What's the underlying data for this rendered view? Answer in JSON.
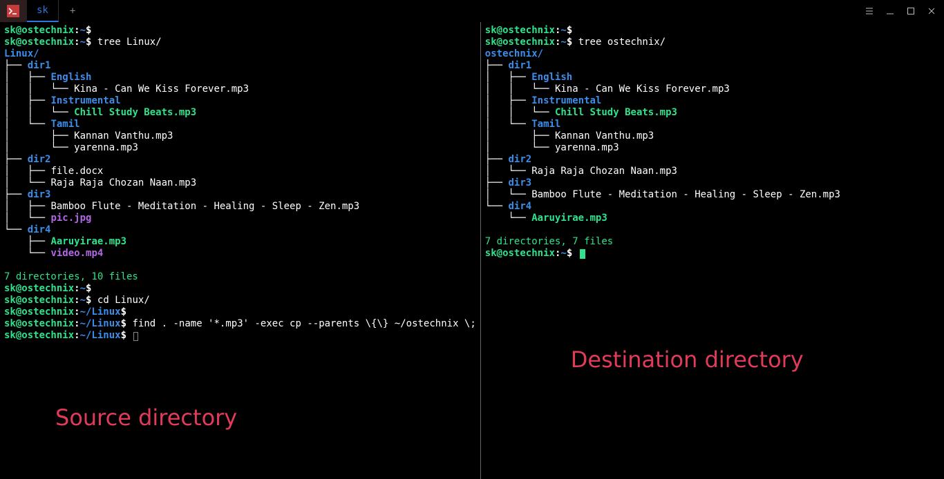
{
  "window": {
    "tab_label": "sk",
    "new_tab_glyph": "+"
  },
  "prompt": {
    "user_host": "sk@ostechnix",
    "home": "~",
    "linux_path": "~/Linux",
    "dollar": "$"
  },
  "left": {
    "cmd_tree": "tree Linux/",
    "root": "Linux/",
    "tree": [
      {
        "pfx": "├── ",
        "cls": "dir",
        "txt": "dir1"
      },
      {
        "pfx": "│   ├── ",
        "cls": "dir",
        "txt": "English"
      },
      {
        "pfx": "│   │   └── ",
        "cls": "file",
        "txt": "Kina - Can We Kiss Forever.mp3"
      },
      {
        "pfx": "│   ├── ",
        "cls": "dir",
        "txt": "Instrumental"
      },
      {
        "pfx": "│   │   └── ",
        "cls": "exec",
        "txt": "Chill Study Beats.mp3"
      },
      {
        "pfx": "│   └── ",
        "cls": "dir",
        "txt": "Tamil"
      },
      {
        "pfx": "│       ├── ",
        "cls": "file",
        "txt": "Kannan Vanthu.mp3"
      },
      {
        "pfx": "│       └── ",
        "cls": "file",
        "txt": "yarenna.mp3"
      },
      {
        "pfx": "├── ",
        "cls": "dir",
        "txt": "dir2"
      },
      {
        "pfx": "│   ├── ",
        "cls": "file",
        "txt": "file.docx"
      },
      {
        "pfx": "│   └── ",
        "cls": "file",
        "txt": "Raja Raja Chozan Naan.mp3"
      },
      {
        "pfx": "├── ",
        "cls": "dir",
        "txt": "dir3"
      },
      {
        "pfx": "│   ├── ",
        "cls": "file",
        "txt": "Bamboo Flute - Meditation - Healing - Sleep - Zen.mp3"
      },
      {
        "pfx": "│   └── ",
        "cls": "media",
        "txt": "pic.jpg"
      },
      {
        "pfx": "└── ",
        "cls": "dir",
        "txt": "dir4"
      },
      {
        "pfx": "    ├── ",
        "cls": "exec",
        "txt": "Aaruyirae.mp3"
      },
      {
        "pfx": "    └── ",
        "cls": "media",
        "txt": "video.mp4"
      }
    ],
    "summary": "7 directories, 10 files",
    "cmd_cd": "cd Linux/",
    "cmd_find": "find . -name '*.mp3' -exec cp --parents \\{\\} ~/ostechnix \\;",
    "overlay": "Source directory"
  },
  "right": {
    "cmd_tree": "tree ostechnix/",
    "root": "ostechnix/",
    "tree": [
      {
        "pfx": "├── ",
        "cls": "dir",
        "txt": "dir1"
      },
      {
        "pfx": "│   ├── ",
        "cls": "dir",
        "txt": "English"
      },
      {
        "pfx": "│   │   └── ",
        "cls": "file",
        "txt": "Kina - Can We Kiss Forever.mp3"
      },
      {
        "pfx": "│   ├── ",
        "cls": "dir",
        "txt": "Instrumental"
      },
      {
        "pfx": "│   │   └── ",
        "cls": "exec",
        "txt": "Chill Study Beats.mp3"
      },
      {
        "pfx": "│   └── ",
        "cls": "dir",
        "txt": "Tamil"
      },
      {
        "pfx": "│       ├── ",
        "cls": "file",
        "txt": "Kannan Vanthu.mp3"
      },
      {
        "pfx": "│       └── ",
        "cls": "file",
        "txt": "yarenna.mp3"
      },
      {
        "pfx": "├── ",
        "cls": "dir",
        "txt": "dir2"
      },
      {
        "pfx": "│   └── ",
        "cls": "file",
        "txt": "Raja Raja Chozan Naan.mp3"
      },
      {
        "pfx": "├── ",
        "cls": "dir",
        "txt": "dir3"
      },
      {
        "pfx": "│   └── ",
        "cls": "file",
        "txt": "Bamboo Flute - Meditation - Healing - Sleep - Zen.mp3"
      },
      {
        "pfx": "└── ",
        "cls": "dir",
        "txt": "dir4"
      },
      {
        "pfx": "    └── ",
        "cls": "exec",
        "txt": "Aaruyirae.mp3"
      }
    ],
    "summary": "7 directories, 7 files",
    "overlay": "Destination directory"
  }
}
